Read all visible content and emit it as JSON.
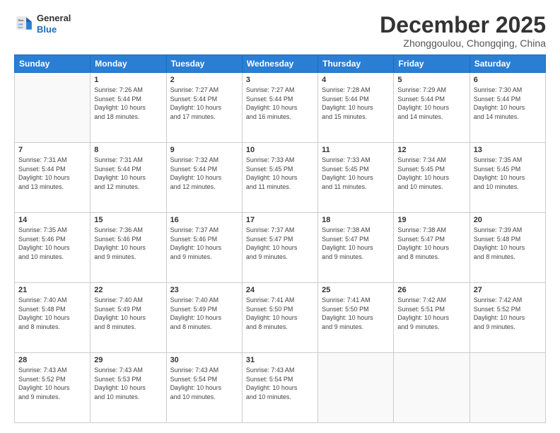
{
  "header": {
    "logo_general": "General",
    "logo_blue": "Blue",
    "month_title": "December 2025",
    "location": "Zhonggoulou, Chongqing, China"
  },
  "days_of_week": [
    "Sunday",
    "Monday",
    "Tuesday",
    "Wednesday",
    "Thursday",
    "Friday",
    "Saturday"
  ],
  "weeks": [
    [
      {
        "day": "",
        "info": ""
      },
      {
        "day": "1",
        "info": "Sunrise: 7:26 AM\nSunset: 5:44 PM\nDaylight: 10 hours\nand 18 minutes."
      },
      {
        "day": "2",
        "info": "Sunrise: 7:27 AM\nSunset: 5:44 PM\nDaylight: 10 hours\nand 17 minutes."
      },
      {
        "day": "3",
        "info": "Sunrise: 7:27 AM\nSunset: 5:44 PM\nDaylight: 10 hours\nand 16 minutes."
      },
      {
        "day": "4",
        "info": "Sunrise: 7:28 AM\nSunset: 5:44 PM\nDaylight: 10 hours\nand 15 minutes."
      },
      {
        "day": "5",
        "info": "Sunrise: 7:29 AM\nSunset: 5:44 PM\nDaylight: 10 hours\nand 14 minutes."
      },
      {
        "day": "6",
        "info": "Sunrise: 7:30 AM\nSunset: 5:44 PM\nDaylight: 10 hours\nand 14 minutes."
      }
    ],
    [
      {
        "day": "7",
        "info": "Sunrise: 7:31 AM\nSunset: 5:44 PM\nDaylight: 10 hours\nand 13 minutes."
      },
      {
        "day": "8",
        "info": "Sunrise: 7:31 AM\nSunset: 5:44 PM\nDaylight: 10 hours\nand 12 minutes."
      },
      {
        "day": "9",
        "info": "Sunrise: 7:32 AM\nSunset: 5:44 PM\nDaylight: 10 hours\nand 12 minutes."
      },
      {
        "day": "10",
        "info": "Sunrise: 7:33 AM\nSunset: 5:45 PM\nDaylight: 10 hours\nand 11 minutes."
      },
      {
        "day": "11",
        "info": "Sunrise: 7:33 AM\nSunset: 5:45 PM\nDaylight: 10 hours\nand 11 minutes."
      },
      {
        "day": "12",
        "info": "Sunrise: 7:34 AM\nSunset: 5:45 PM\nDaylight: 10 hours\nand 10 minutes."
      },
      {
        "day": "13",
        "info": "Sunrise: 7:35 AM\nSunset: 5:45 PM\nDaylight: 10 hours\nand 10 minutes."
      }
    ],
    [
      {
        "day": "14",
        "info": "Sunrise: 7:35 AM\nSunset: 5:46 PM\nDaylight: 10 hours\nand 10 minutes."
      },
      {
        "day": "15",
        "info": "Sunrise: 7:36 AM\nSunset: 5:46 PM\nDaylight: 10 hours\nand 9 minutes."
      },
      {
        "day": "16",
        "info": "Sunrise: 7:37 AM\nSunset: 5:46 PM\nDaylight: 10 hours\nand 9 minutes."
      },
      {
        "day": "17",
        "info": "Sunrise: 7:37 AM\nSunset: 5:47 PM\nDaylight: 10 hours\nand 9 minutes."
      },
      {
        "day": "18",
        "info": "Sunrise: 7:38 AM\nSunset: 5:47 PM\nDaylight: 10 hours\nand 9 minutes."
      },
      {
        "day": "19",
        "info": "Sunrise: 7:38 AM\nSunset: 5:47 PM\nDaylight: 10 hours\nand 8 minutes."
      },
      {
        "day": "20",
        "info": "Sunrise: 7:39 AM\nSunset: 5:48 PM\nDaylight: 10 hours\nand 8 minutes."
      }
    ],
    [
      {
        "day": "21",
        "info": "Sunrise: 7:40 AM\nSunset: 5:48 PM\nDaylight: 10 hours\nand 8 minutes."
      },
      {
        "day": "22",
        "info": "Sunrise: 7:40 AM\nSunset: 5:49 PM\nDaylight: 10 hours\nand 8 minutes."
      },
      {
        "day": "23",
        "info": "Sunrise: 7:40 AM\nSunset: 5:49 PM\nDaylight: 10 hours\nand 8 minutes."
      },
      {
        "day": "24",
        "info": "Sunrise: 7:41 AM\nSunset: 5:50 PM\nDaylight: 10 hours\nand 8 minutes."
      },
      {
        "day": "25",
        "info": "Sunrise: 7:41 AM\nSunset: 5:50 PM\nDaylight: 10 hours\nand 9 minutes."
      },
      {
        "day": "26",
        "info": "Sunrise: 7:42 AM\nSunset: 5:51 PM\nDaylight: 10 hours\nand 9 minutes."
      },
      {
        "day": "27",
        "info": "Sunrise: 7:42 AM\nSunset: 5:52 PM\nDaylight: 10 hours\nand 9 minutes."
      }
    ],
    [
      {
        "day": "28",
        "info": "Sunrise: 7:43 AM\nSunset: 5:52 PM\nDaylight: 10 hours\nand 9 minutes."
      },
      {
        "day": "29",
        "info": "Sunrise: 7:43 AM\nSunset: 5:53 PM\nDaylight: 10 hours\nand 10 minutes."
      },
      {
        "day": "30",
        "info": "Sunrise: 7:43 AM\nSunset: 5:54 PM\nDaylight: 10 hours\nand 10 minutes."
      },
      {
        "day": "31",
        "info": "Sunrise: 7:43 AM\nSunset: 5:54 PM\nDaylight: 10 hours\nand 10 minutes."
      },
      {
        "day": "",
        "info": ""
      },
      {
        "day": "",
        "info": ""
      },
      {
        "day": "",
        "info": ""
      }
    ]
  ]
}
